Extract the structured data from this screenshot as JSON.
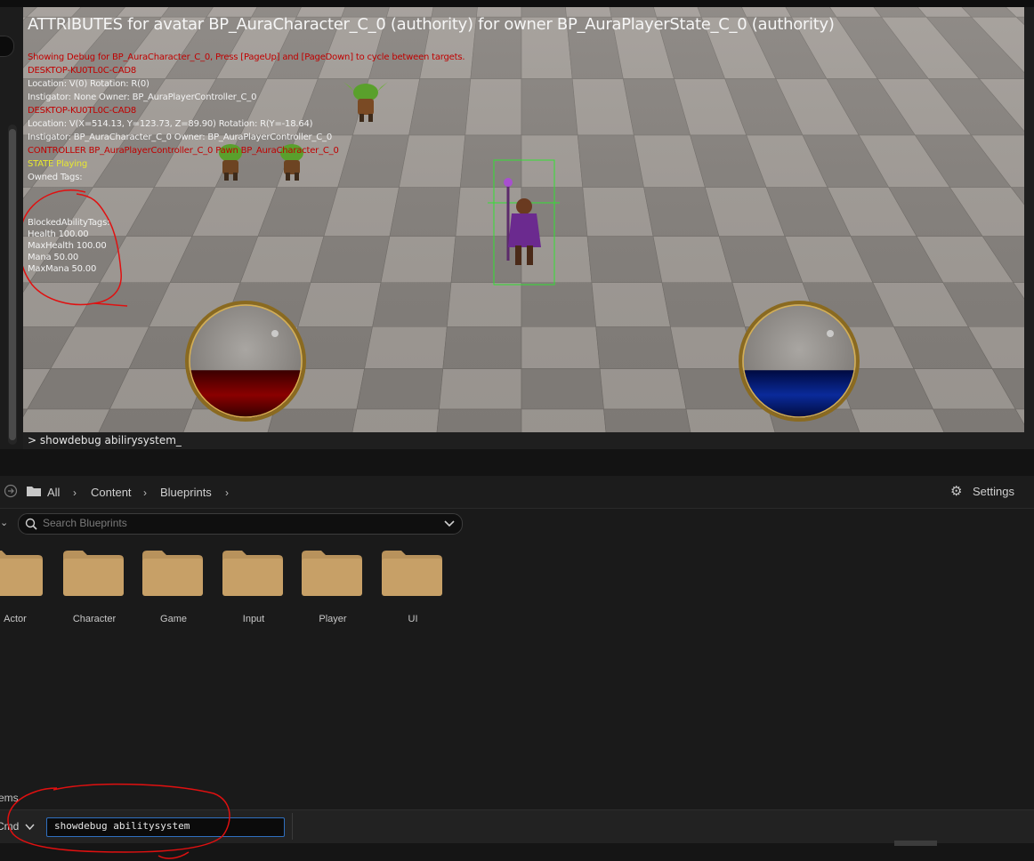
{
  "viewport": {
    "title": "ATTRIBUTES for avatar BP_AuraCharacter_C_0 (authority) for owner BP_AuraPlayerState_C_0 (authority)",
    "debug_lines": {
      "showing": "Showing Debug for BP_AuraCharacter_C_0, Press [PageUp] and [PageDown] to cycle between targets.",
      "machine1": "DESKTOP-KU0TL0C-CAD8",
      "location1": "Location: V(0) Rotation: R(0)",
      "instigator1": " Instigator: None Owner: BP_AuraPlayerController_C_0",
      "machine2": "DESKTOP-KU0TL0C-CAD8",
      "location2": "Location: V(X=514.13, Y=123.73, Z=89.90) Rotation: R(Y=-18.64)",
      "instigator2": " Instigator: BP_AuraCharacter_C_0 Owner: BP_AuraPlayerController_C_0",
      "controller": "CONTROLLER BP_AuraPlayerController_C_0 Pawn BP_AuraCharacter_C_0",
      "state": "STATE Playing",
      "owned_tags": "Owned Tags:",
      "blocked_tags": "BlockedAbilityTags:",
      "health": "Health 100.00",
      "max_health": "MaxHealth 100.00",
      "mana": "Mana 50.00",
      "max_mana": "MaxMana 50.00"
    },
    "health_globe_fill": 0.42,
    "mana_globe_fill": 0.42,
    "health_color": "#8a0000",
    "mana_color": "#0a2a9a"
  },
  "console": {
    "text": "> showdebug abilirysystem_"
  },
  "content_browser": {
    "breadcrumb": [
      "All",
      "Content",
      "Blueprints"
    ],
    "settings_label": "Settings",
    "search_placeholder": "Search Blueprints",
    "folders": [
      "Actor",
      "Character",
      "Game",
      "Input",
      "Player",
      "UI"
    ],
    "items_label": "ems"
  },
  "bottom_bar": {
    "cmd_label": "Cmd",
    "cmd_value": "showdebug abilitysystem"
  },
  "colors": {
    "annotation_red": "#e01010",
    "folder": "#b8925c",
    "input_border": "#2f6fbf"
  }
}
